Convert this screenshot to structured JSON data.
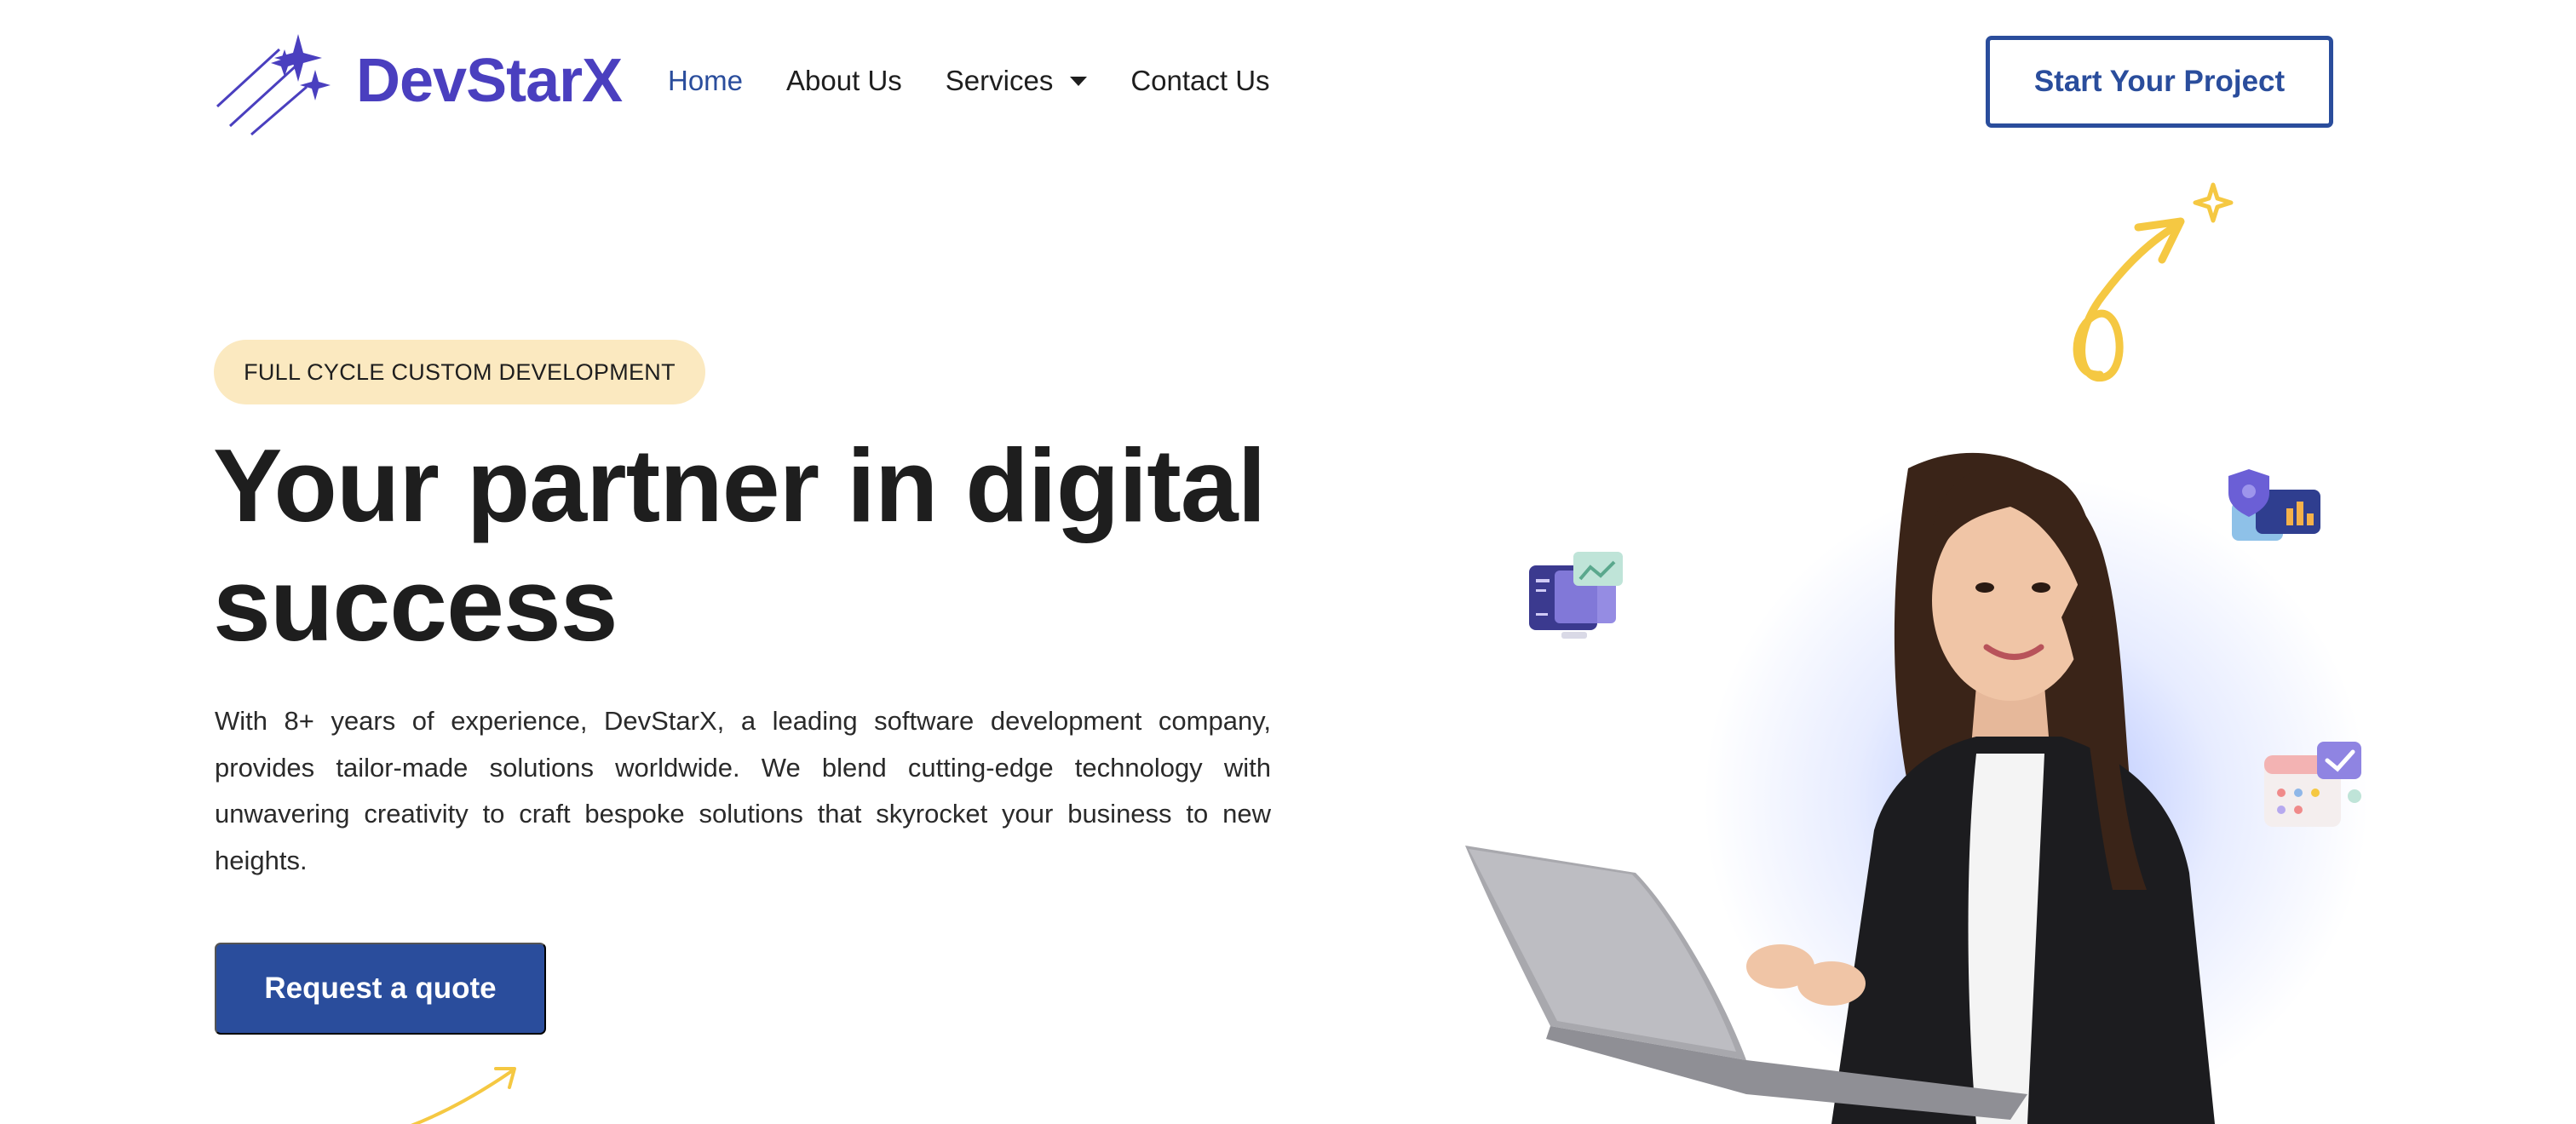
{
  "brand": {
    "name": "DevStarX",
    "logo_icon": "shooting-stars-icon",
    "color": "#4a3fbf"
  },
  "nav": {
    "items": [
      {
        "label": "Home",
        "active": true
      },
      {
        "label": "About Us",
        "active": false
      },
      {
        "label": "Services",
        "active": false,
        "has_dropdown": true
      },
      {
        "label": "Contact Us",
        "active": false
      }
    ]
  },
  "header_cta": {
    "label": "Start Your Project"
  },
  "hero": {
    "badge": "FULL CYCLE CUSTOM DEVELOPMENT",
    "headline_line1": "Your partner in digital",
    "headline_line2": "success",
    "lead": "With 8+ years of experience, DevStarX, a leading software development company, provides tailor-made solutions worldwide. We blend cutting-edge technology with unwavering creativity to craft bespoke solutions that skyrocket your business to new heights.",
    "cta": "Request a quote"
  },
  "colors": {
    "primary": "#2a4d9c",
    "badge_bg": "#fbe9c0",
    "accent_yellow": "#f5c842",
    "text": "#1e1e1e"
  },
  "illustrations": [
    "hand-drawn-arrow-icon",
    "sparkle-icon",
    "monitor-card-icon",
    "shield-dashboard-icon",
    "calendar-check-icon",
    "woman-with-laptop-photo"
  ]
}
